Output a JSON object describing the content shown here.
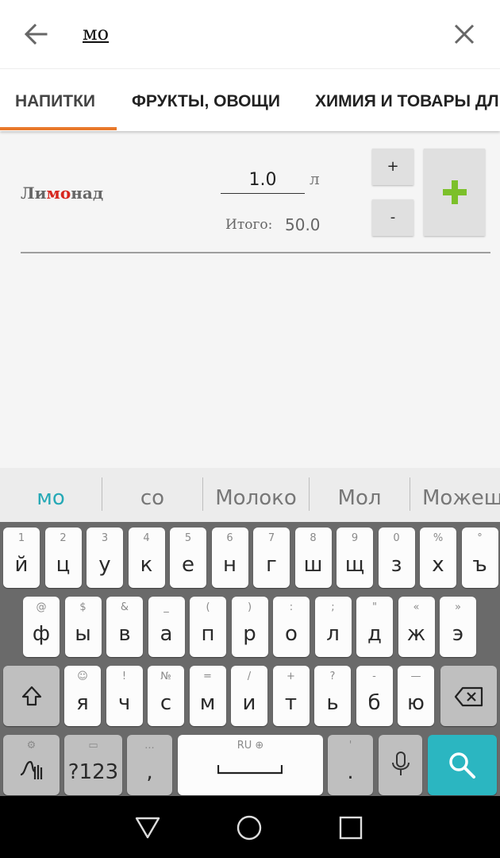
{
  "search": {
    "query": "мо"
  },
  "tabs": [
    {
      "label": "НАПИТКИ",
      "active": true
    },
    {
      "label": "ФРУКТЫ, ОВОЩИ",
      "active": false
    },
    {
      "label": "ХИМИЯ И ТОВАРЫ ДЛ",
      "active": false
    }
  ],
  "product": {
    "name_pre": "Ли",
    "name_match": "мо",
    "name_post": "над",
    "quantity": "1.0",
    "unit": "л",
    "total_label": "Итого:",
    "total_value": "50.0",
    "plus_label": "+",
    "minus_label": "-"
  },
  "colors": {
    "accent": "#e8782a",
    "highlight": "#d7261e",
    "add_icon": "#7cc02a",
    "keyboard_action": "#2bb6c1"
  },
  "keyboard": {
    "suggestions": [
      "мо",
      "со",
      "Молоко",
      "Мол",
      "Можеш"
    ],
    "row1": [
      {
        "k": "й",
        "h": "1"
      },
      {
        "k": "ц",
        "h": "2"
      },
      {
        "k": "у",
        "h": "3"
      },
      {
        "k": "к",
        "h": "4"
      },
      {
        "k": "е",
        "h": "5"
      },
      {
        "k": "н",
        "h": "6"
      },
      {
        "k": "г",
        "h": "7"
      },
      {
        "k": "ш",
        "h": "8"
      },
      {
        "k": "щ",
        "h": "9"
      },
      {
        "k": "з",
        "h": "0"
      },
      {
        "k": "х",
        "h": "%"
      },
      {
        "k": "ъ",
        "h": "°"
      }
    ],
    "row2": [
      {
        "k": "ф",
        "h": "@"
      },
      {
        "k": "ы",
        "h": "$"
      },
      {
        "k": "в",
        "h": "&"
      },
      {
        "k": "а",
        "h": "_"
      },
      {
        "k": "п",
        "h": "("
      },
      {
        "k": "р",
        "h": ")"
      },
      {
        "k": "о",
        "h": ":"
      },
      {
        "k": "л",
        "h": ";"
      },
      {
        "k": "д",
        "h": "\""
      },
      {
        "k": "ж",
        "h": "«"
      },
      {
        "k": "э",
        "h": "»"
      }
    ],
    "row3": [
      {
        "k": "я",
        "h": "☺"
      },
      {
        "k": "ч",
        "h": "!"
      },
      {
        "k": "с",
        "h": "№"
      },
      {
        "k": "м",
        "h": "="
      },
      {
        "k": "и",
        "h": "/"
      },
      {
        "k": "т",
        "h": "+"
      },
      {
        "k": "ь",
        "h": "?"
      },
      {
        "k": "б",
        "h": "-"
      },
      {
        "k": "ю",
        "h": "—"
      }
    ],
    "symbols_label": "?123",
    "comma_key": ",",
    "comma_hint": "...",
    "space_hint": "RU ⊕",
    "period_key": ".",
    "period_hint": "'"
  }
}
